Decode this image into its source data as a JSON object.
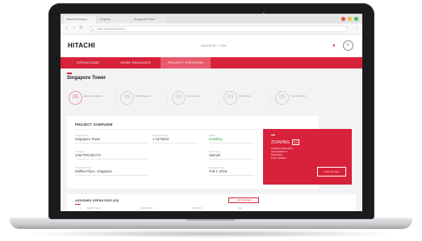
{
  "browser": {
    "tabs": [
      {
        "label": "Hitachi Elevators"
      },
      {
        "label": "Projects"
      },
      {
        "label": "Singapore Tower"
      }
    ],
    "url": "https://projects.hitachi",
    "window_dots": [
      "#f04f45",
      "#f3b93d",
      "#3fc350"
    ]
  },
  "header": {
    "logo": "HITACHI",
    "center_text": "INDUSTRY / USE",
    "icons": {
      "notification": "bell-icon",
      "user": "user-icon"
    }
  },
  "nav": {
    "tabs": [
      {
        "label": "OPERATIONS",
        "active": false
      },
      {
        "label": "WORK PACKAGES",
        "active": false
      },
      {
        "label": "PROJECT OVERVIEW",
        "active": true
      }
    ]
  },
  "page": {
    "title": "Singapore Tower"
  },
  "kpis": [
    {
      "value": "06",
      "label": "Elevators Installed",
      "accent": true
    },
    {
      "value": "06",
      "label": "Total Elevators",
      "accent": false
    },
    {
      "value": "00",
      "label": "Open Issues",
      "accent": false
    },
    {
      "value": "03",
      "label": "Total Zones",
      "accent": false
    },
    {
      "value": "05",
      "label": "Total Operators",
      "accent": false
    }
  ],
  "overview": {
    "title": "PROJECT OVERVIEW",
    "fields": [
      {
        "label": "Project Name",
        "value": "Singapore Tower",
        "status": false
      },
      {
        "label": "Project Number",
        "value": "1-1478294",
        "status": false
      },
      {
        "label": "Status",
        "value": "Installing",
        "status": true
      },
      {
        "label": "Company",
        "value": "JAM PROJECTS",
        "status": false
      },
      {
        "label": "Supervisor",
        "value": "Samuel",
        "status": false
      },
      {
        "label": "Project Address",
        "value": "Raffles Place, Singapore",
        "status": false
      },
      {
        "label": "Handover Date",
        "value": "Feb 4, 2019",
        "status": false
      }
    ]
  },
  "zoning": {
    "title": "ZONING",
    "count": "03",
    "lines": [
      "Zoning is active since",
      "Last updated on:",
      "8 Feb 2019",
      "Time: 12:00am"
    ],
    "button": "View Zoning"
  },
  "assigned": {
    "title": "ASSIGNED OPERATORS (05)",
    "button": "+ Add Operator",
    "columns": [
      "#",
      "Operator Name",
      "Elevators ID",
      "Workfront",
      "Role"
    ]
  },
  "colors": {
    "brand_red": "#d8213a",
    "status_green": "#3aa655"
  }
}
